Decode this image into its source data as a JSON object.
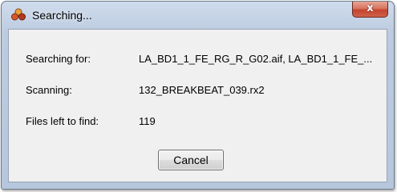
{
  "window": {
    "title": "Searching...",
    "app_icon": "app-logo-icon",
    "close_icon": "close-icon",
    "close_glyph": "x"
  },
  "fields": [
    {
      "label": "Searching for:",
      "value": "LA_BD1_1_FE_RG_R_G02.aif, LA_BD1_1_FE_..."
    },
    {
      "label": "Scanning:",
      "value": "132_BREAKBEAT_039.rx2"
    },
    {
      "label": "Files left to find:",
      "value": "119"
    }
  ],
  "buttons": {
    "cancel_label": "Cancel"
  },
  "colors": {
    "titlebar": "#c5d4e8",
    "client_background": "#f0f0f0",
    "close_button": "#c9503a"
  }
}
